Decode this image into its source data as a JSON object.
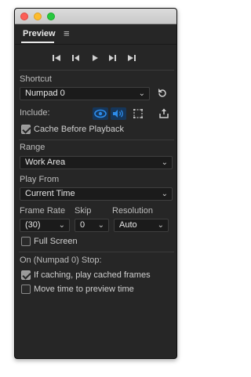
{
  "panel": {
    "title": "Preview"
  },
  "transport": {
    "first_frame": "⏮",
    "previous_frame": "◀",
    "play": "▶",
    "next_frame": "▶",
    "last_frame": "⏭"
  },
  "shortcut": {
    "label": "Shortcut",
    "value": "Numpad 0"
  },
  "include": {
    "label": "Include:"
  },
  "cache_before_playback": {
    "label": "Cache Before Playback",
    "checked": true
  },
  "range": {
    "label": "Range",
    "value": "Work Area"
  },
  "play_from": {
    "label": "Play From",
    "value": "Current Time"
  },
  "frame_rate": {
    "label": "Frame Rate",
    "value": "(30)"
  },
  "skip": {
    "label": "Skip",
    "value": "0"
  },
  "resolution": {
    "label": "Resolution",
    "value": "Auto"
  },
  "full_screen": {
    "label": "Full Screen",
    "checked": false
  },
  "stop_section": {
    "label": "On (Numpad 0) Stop:"
  },
  "if_caching": {
    "label": "If caching, play cached frames",
    "checked": true
  },
  "move_time": {
    "label": "Move time to preview time",
    "checked": false
  },
  "colors": {
    "panel_bg": "#262626",
    "accent": "#2d8ceb",
    "field_bg": "#1b1b1b"
  }
}
